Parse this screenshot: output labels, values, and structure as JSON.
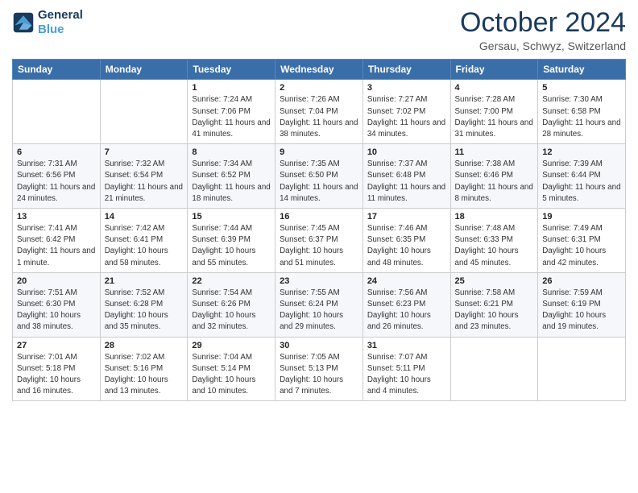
{
  "header": {
    "logo_line1": "General",
    "logo_line2": "Blue",
    "month": "October 2024",
    "location": "Gersau, Schwyz, Switzerland"
  },
  "weekdays": [
    "Sunday",
    "Monday",
    "Tuesday",
    "Wednesday",
    "Thursday",
    "Friday",
    "Saturday"
  ],
  "weeks": [
    [
      {
        "day": "",
        "info": ""
      },
      {
        "day": "",
        "info": ""
      },
      {
        "day": "1",
        "info": "Sunrise: 7:24 AM\nSunset: 7:06 PM\nDaylight: 11 hours and 41 minutes."
      },
      {
        "day": "2",
        "info": "Sunrise: 7:26 AM\nSunset: 7:04 PM\nDaylight: 11 hours and 38 minutes."
      },
      {
        "day": "3",
        "info": "Sunrise: 7:27 AM\nSunset: 7:02 PM\nDaylight: 11 hours and 34 minutes."
      },
      {
        "day": "4",
        "info": "Sunrise: 7:28 AM\nSunset: 7:00 PM\nDaylight: 11 hours and 31 minutes."
      },
      {
        "day": "5",
        "info": "Sunrise: 7:30 AM\nSunset: 6:58 PM\nDaylight: 11 hours and 28 minutes."
      }
    ],
    [
      {
        "day": "6",
        "info": "Sunrise: 7:31 AM\nSunset: 6:56 PM\nDaylight: 11 hours and 24 minutes."
      },
      {
        "day": "7",
        "info": "Sunrise: 7:32 AM\nSunset: 6:54 PM\nDaylight: 11 hours and 21 minutes."
      },
      {
        "day": "8",
        "info": "Sunrise: 7:34 AM\nSunset: 6:52 PM\nDaylight: 11 hours and 18 minutes."
      },
      {
        "day": "9",
        "info": "Sunrise: 7:35 AM\nSunset: 6:50 PM\nDaylight: 11 hours and 14 minutes."
      },
      {
        "day": "10",
        "info": "Sunrise: 7:37 AM\nSunset: 6:48 PM\nDaylight: 11 hours and 11 minutes."
      },
      {
        "day": "11",
        "info": "Sunrise: 7:38 AM\nSunset: 6:46 PM\nDaylight: 11 hours and 8 minutes."
      },
      {
        "day": "12",
        "info": "Sunrise: 7:39 AM\nSunset: 6:44 PM\nDaylight: 11 hours and 5 minutes."
      }
    ],
    [
      {
        "day": "13",
        "info": "Sunrise: 7:41 AM\nSunset: 6:42 PM\nDaylight: 11 hours and 1 minute."
      },
      {
        "day": "14",
        "info": "Sunrise: 7:42 AM\nSunset: 6:41 PM\nDaylight: 10 hours and 58 minutes."
      },
      {
        "day": "15",
        "info": "Sunrise: 7:44 AM\nSunset: 6:39 PM\nDaylight: 10 hours and 55 minutes."
      },
      {
        "day": "16",
        "info": "Sunrise: 7:45 AM\nSunset: 6:37 PM\nDaylight: 10 hours and 51 minutes."
      },
      {
        "day": "17",
        "info": "Sunrise: 7:46 AM\nSunset: 6:35 PM\nDaylight: 10 hours and 48 minutes."
      },
      {
        "day": "18",
        "info": "Sunrise: 7:48 AM\nSunset: 6:33 PM\nDaylight: 10 hours and 45 minutes."
      },
      {
        "day": "19",
        "info": "Sunrise: 7:49 AM\nSunset: 6:31 PM\nDaylight: 10 hours and 42 minutes."
      }
    ],
    [
      {
        "day": "20",
        "info": "Sunrise: 7:51 AM\nSunset: 6:30 PM\nDaylight: 10 hours and 38 minutes."
      },
      {
        "day": "21",
        "info": "Sunrise: 7:52 AM\nSunset: 6:28 PM\nDaylight: 10 hours and 35 minutes."
      },
      {
        "day": "22",
        "info": "Sunrise: 7:54 AM\nSunset: 6:26 PM\nDaylight: 10 hours and 32 minutes."
      },
      {
        "day": "23",
        "info": "Sunrise: 7:55 AM\nSunset: 6:24 PM\nDaylight: 10 hours and 29 minutes."
      },
      {
        "day": "24",
        "info": "Sunrise: 7:56 AM\nSunset: 6:23 PM\nDaylight: 10 hours and 26 minutes."
      },
      {
        "day": "25",
        "info": "Sunrise: 7:58 AM\nSunset: 6:21 PM\nDaylight: 10 hours and 23 minutes."
      },
      {
        "day": "26",
        "info": "Sunrise: 7:59 AM\nSunset: 6:19 PM\nDaylight: 10 hours and 19 minutes."
      }
    ],
    [
      {
        "day": "27",
        "info": "Sunrise: 7:01 AM\nSunset: 5:18 PM\nDaylight: 10 hours and 16 minutes."
      },
      {
        "day": "28",
        "info": "Sunrise: 7:02 AM\nSunset: 5:16 PM\nDaylight: 10 hours and 13 minutes."
      },
      {
        "day": "29",
        "info": "Sunrise: 7:04 AM\nSunset: 5:14 PM\nDaylight: 10 hours and 10 minutes."
      },
      {
        "day": "30",
        "info": "Sunrise: 7:05 AM\nSunset: 5:13 PM\nDaylight: 10 hours and 7 minutes."
      },
      {
        "day": "31",
        "info": "Sunrise: 7:07 AM\nSunset: 5:11 PM\nDaylight: 10 hours and 4 minutes."
      },
      {
        "day": "",
        "info": ""
      },
      {
        "day": "",
        "info": ""
      }
    ]
  ]
}
